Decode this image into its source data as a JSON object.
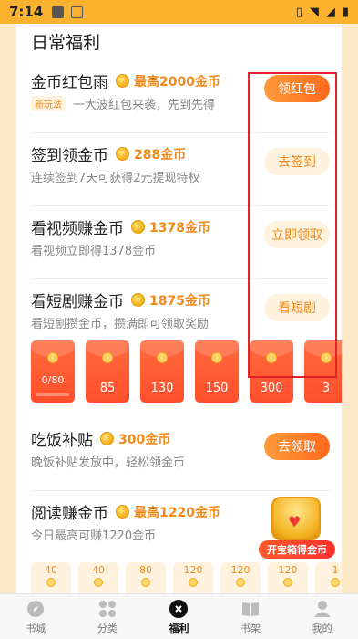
{
  "status_bar": {
    "time": "7:14",
    "a_icon_label": "A"
  },
  "section": {
    "title": "日常福利"
  },
  "tasks": [
    {
      "title": "金币红包雨",
      "reward": "最高2000金币",
      "tag": "新玩法",
      "desc": "一大波红包来袭，先到先得",
      "button": "领红包",
      "button_style": "primary"
    },
    {
      "title": "签到领金币",
      "reward": "288金币",
      "desc": "连续签到7天可获得2元提现特权",
      "button": "去签到",
      "button_style": "soft"
    },
    {
      "title": "看视频赚金币",
      "reward": "1378金币",
      "desc": "看视频立即得1378金币",
      "button": "立即领取",
      "button_style": "soft"
    },
    {
      "title": "看短剧赚金币",
      "reward": "1875金币",
      "desc": "看短剧攒金币，攒满即可领取奖励",
      "button": "看短剧",
      "button_style": "soft"
    }
  ],
  "envelopes": [
    {
      "label": "0/80",
      "progress": 0.0
    },
    {
      "label": "85"
    },
    {
      "label": "130"
    },
    {
      "label": "150"
    },
    {
      "label": "300"
    },
    {
      "label": "3"
    }
  ],
  "lunch": {
    "title": "吃饭补贴",
    "reward": "300金币",
    "desc": "晚饭补贴发放中，轻松领金币",
    "button": "去领取"
  },
  "reading": {
    "title": "阅读赚金币",
    "reward": "最高1220金币",
    "desc": "今日最高可赚1220金币",
    "chips": [
      "40",
      "40",
      "80",
      "120",
      "120",
      "120",
      "1"
    ]
  },
  "chest": {
    "label": "开宝箱得金币"
  },
  "tabbar": {
    "items": [
      {
        "label": "书城",
        "icon": "compass-icon"
      },
      {
        "label": "分类",
        "icon": "grid-icon"
      },
      {
        "label": "福利",
        "icon": "welfare-icon",
        "active": true
      },
      {
        "label": "书架",
        "icon": "book-icon"
      },
      {
        "label": "我的",
        "icon": "person-icon"
      }
    ]
  },
  "colors": {
    "accent": "#ff6a1d",
    "coin": "#f6b51e",
    "status_bar": "#fbb22e",
    "highlight": "#e0242b"
  }
}
